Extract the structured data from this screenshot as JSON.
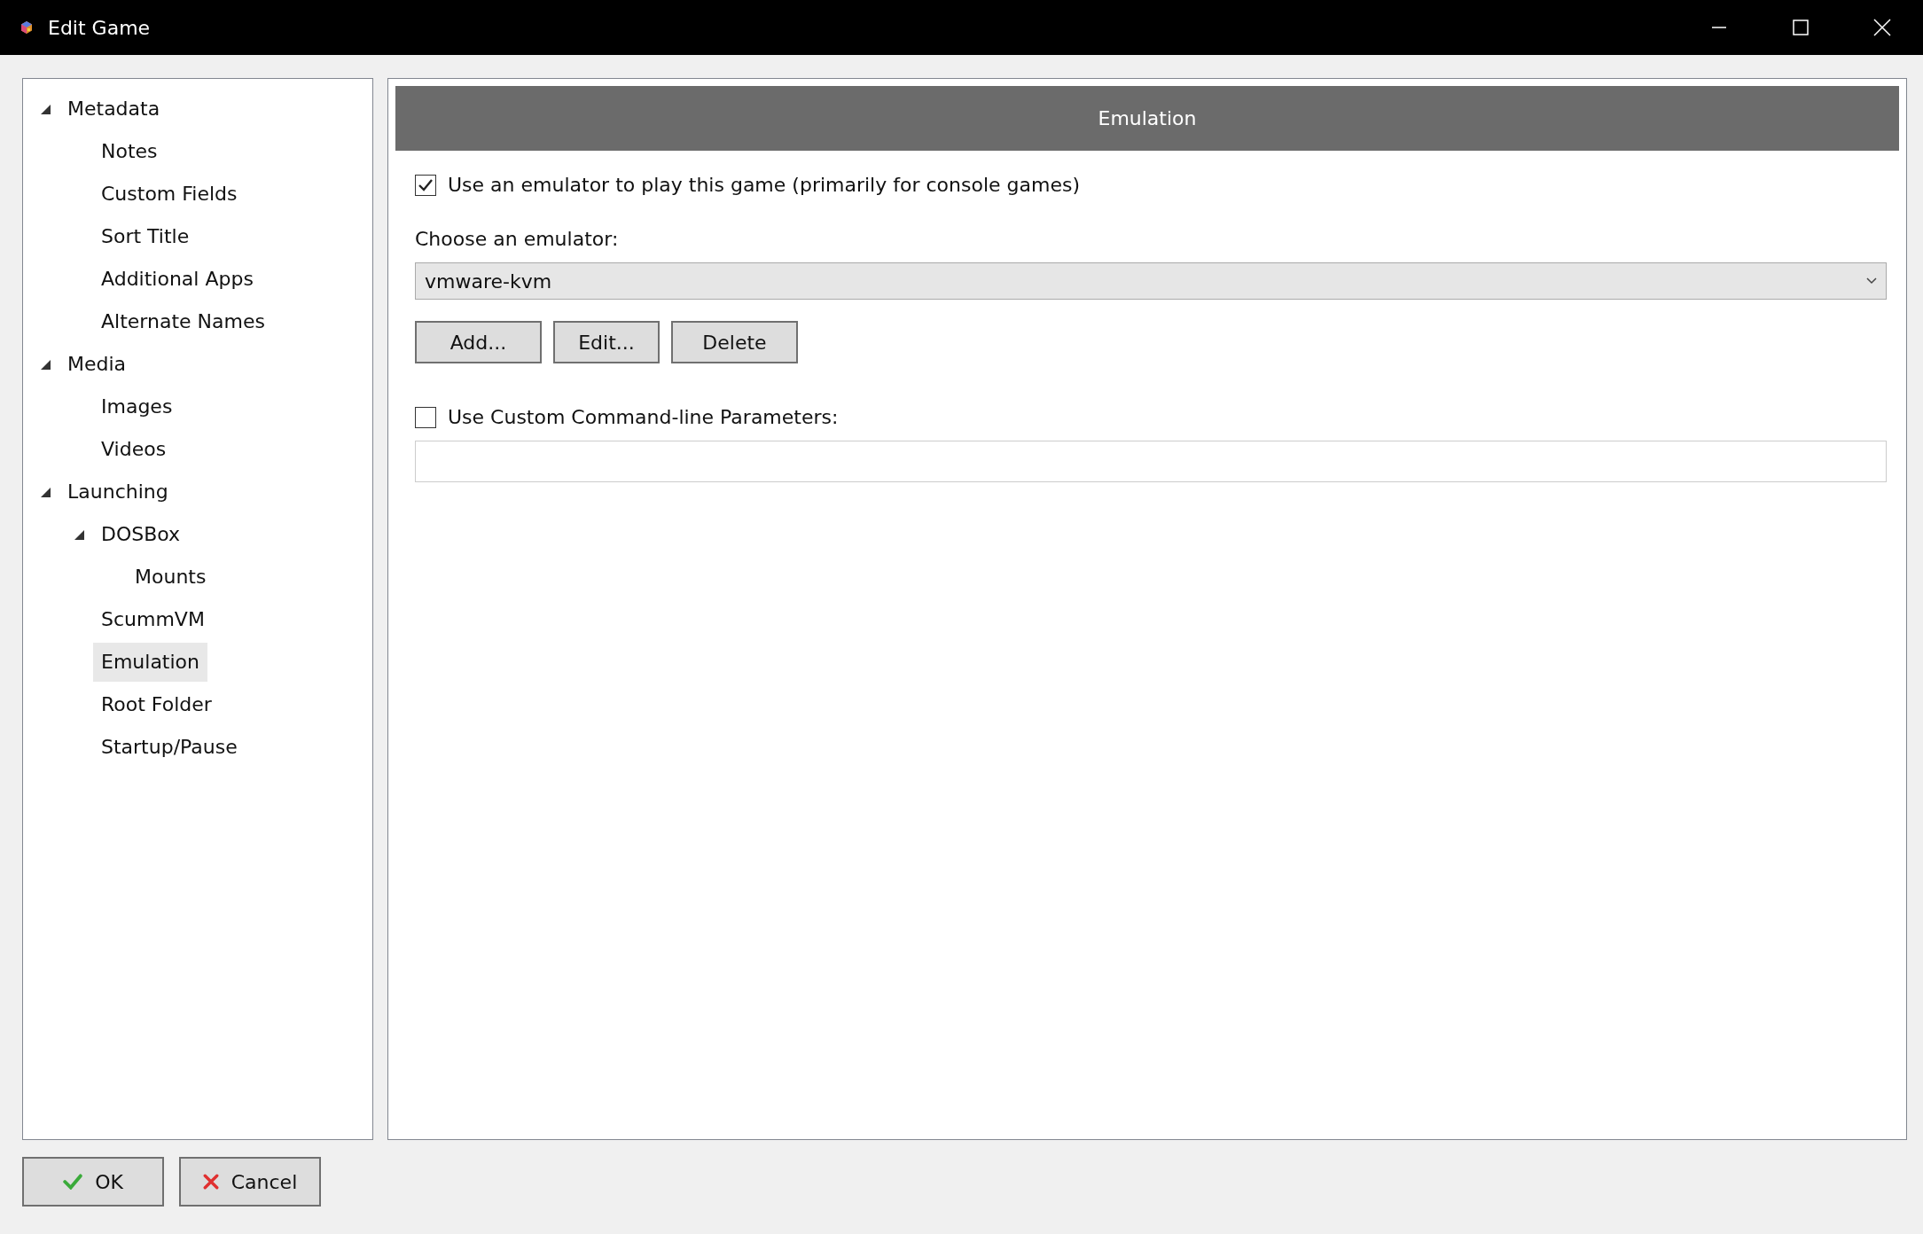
{
  "window": {
    "title": "Edit Game"
  },
  "tree": [
    {
      "label": "Metadata",
      "expanded": true,
      "selected": false,
      "children": [
        {
          "label": "Notes",
          "selected": false
        },
        {
          "label": "Custom Fields",
          "selected": false
        },
        {
          "label": "Sort Title",
          "selected": false
        },
        {
          "label": "Additional Apps",
          "selected": false
        },
        {
          "label": "Alternate Names",
          "selected": false
        }
      ]
    },
    {
      "label": "Media",
      "expanded": true,
      "selected": false,
      "children": [
        {
          "label": "Images",
          "selected": false
        },
        {
          "label": "Videos",
          "selected": false
        }
      ]
    },
    {
      "label": "Launching",
      "expanded": true,
      "selected": false,
      "children": [
        {
          "label": "DOSBox",
          "expanded": true,
          "selected": false,
          "children": [
            {
              "label": "Mounts",
              "selected": false
            }
          ]
        },
        {
          "label": "ScummVM",
          "selected": false
        },
        {
          "label": "Emulation",
          "selected": true
        },
        {
          "label": "Root Folder",
          "selected": false
        },
        {
          "label": "Startup/Pause",
          "selected": false
        }
      ]
    }
  ],
  "panel": {
    "header": "Emulation",
    "use_emulator": {
      "label": "Use an emulator to play this game (primarily for console games)",
      "checked": true
    },
    "emulator_label": "Choose an emulator:",
    "emulator": {
      "value": "vmware-kvm"
    },
    "buttons": [
      "Add...",
      "Edit...",
      "Delete"
    ],
    "custom_params": {
      "label": "Use Custom Command-line Parameters:",
      "checked": false
    }
  },
  "footer_buttons": [
    {
      "kind": "ok",
      "label": "OK"
    },
    {
      "kind": "cancel",
      "label": "Cancel"
    }
  ]
}
